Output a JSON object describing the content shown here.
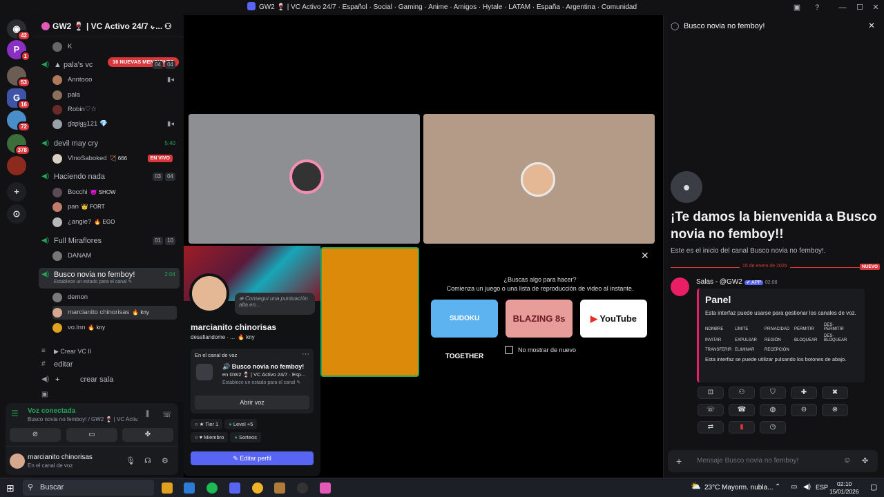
{
  "window": {
    "title": "GW2 🍷 | VC Activo 24/7 · Español · Social · Gaming · Anime · Amigos · Hytale · LATAM · España · Argentina · Comunidad"
  },
  "servers": [
    {
      "badge": "42"
    },
    {
      "badge": "1"
    },
    {
      "badge": "53"
    },
    {
      "badge": "16"
    },
    {
      "badge": "72"
    },
    {
      "badge": "378"
    }
  ],
  "server": {
    "name": "GW2 🍷 | VC Activo 24/7 · ..."
  },
  "mentions": "16 NUEVAS MENCIONES",
  "channels": {
    "partial_user": "K",
    "pala": {
      "name": "pala's vc",
      "count_a": "04",
      "count_b": "04",
      "users": [
        "Anntooo",
        "pala",
        "Robin♡☆",
        "ɠαʂƚყყ121 💎"
      ]
    },
    "devil": {
      "name": "devil may cry",
      "time": "5:40",
      "users": [
        {
          "name": "VlnoSaboked",
          "tag": "🏹 666",
          "live": "EN VIVO"
        }
      ]
    },
    "haciendo": {
      "name": "Haciendo nada",
      "count_a": "03",
      "count_b": "04",
      "users": [
        {
          "name": "Bocchi",
          "tag": "😈 SHOW"
        },
        {
          "name": "pan",
          "tag": "👑 FORT"
        },
        {
          "name": "¿angie?",
          "tag": "🔥 EGO"
        }
      ]
    },
    "full": {
      "name": "Full Miraflores",
      "count_a": "01",
      "count_b": "10",
      "users": [
        "DANAM"
      ]
    },
    "busco": {
      "name": "Busco novia no femboy!",
      "time": "2:04",
      "status": "Establece un estado para el canal ✎",
      "users": [
        {
          "name": "demon",
          "tag": ""
        },
        {
          "name": "marcianito chinorisas",
          "tag": "🔥 kny"
        },
        {
          "name": "vo.lnn",
          "tag": "🔥 kny"
        }
      ]
    },
    "crear": "Crear VC II",
    "editar": "editar",
    "sala": "crear sala"
  },
  "voice": {
    "status": "Voz conectada",
    "where": "Busco novia no femboy! / GW2 🍷 | VC Activ..."
  },
  "user": {
    "name": "marcianito chinorisas",
    "status": "En el canal de voz"
  },
  "activity": {
    "q": "¿Buscas algo para hacer?",
    "sub": "Comienza un juego o una lista de reproducción de video al instante.",
    "games": [
      "SUDOKU TOGETHER",
      "BLAZING 8s",
      "YouTube"
    ],
    "dont_show": "No mostrar de nuevo"
  },
  "popout": {
    "placeholder": "Consegui una puntuación alta en...",
    "name": "marcianito chinorisas",
    "handle": "desafiandome · ...",
    "handle_tag": "🔥 kny",
    "voice_label": "En el canal de voz",
    "channel": "🔊 Busco novia no femboy!",
    "server": "en GW2 🍷 | VC Activo 24/7 · Esp...",
    "status": "Establece un estado para el canal ✎",
    "open_voice": "Abrir voz",
    "roles": [
      "Tier 1",
      "Level +5",
      "Miembro",
      "Sorteos"
    ],
    "edit": "✎ Editar perfil"
  },
  "thread": {
    "title": "Busco novia no femboy!",
    "welcome": "¡Te damos la bienvenida a Busco novia no femboy!!",
    "start": "Este es el inicio del canal Busco novia no femboy!.",
    "date": "15 de enero de 2026",
    "new_label": "NUEVO",
    "author": "Salas - @GW2",
    "app": "✔ APP",
    "time": "02:08",
    "panel_title": "Panel",
    "panel_desc": "Esta interfaz puede usarse para gestionar los canales de voz.",
    "panel_btns": [
      "NOMBRE",
      "LÍMITE",
      "PRIVACIDAD",
      "PERMITIR",
      "DES-PERMITIR",
      "INVITAR",
      "EXPULSAR",
      "REGIÓN",
      "BLOQUEAR",
      "DES-BLOQUEAR",
      "TRANSFERIR",
      "ELIMINAR",
      "RECEPCIÓN"
    ],
    "panel_foot": "Esta interfaz se puede utilizar pulsando los botones de abajo.",
    "input_placeholder": "Mensaje Busco novia no femboy!"
  },
  "taskbar": {
    "search": "Buscar",
    "weather": "23°C",
    "forecast": "Mayorm. nubla...",
    "lang": "ESP",
    "time": "02:10",
    "date": "15/01/2026"
  },
  "colors": {
    "accent": "#5865f2",
    "green": "#23a55a",
    "red": "#da373c"
  }
}
